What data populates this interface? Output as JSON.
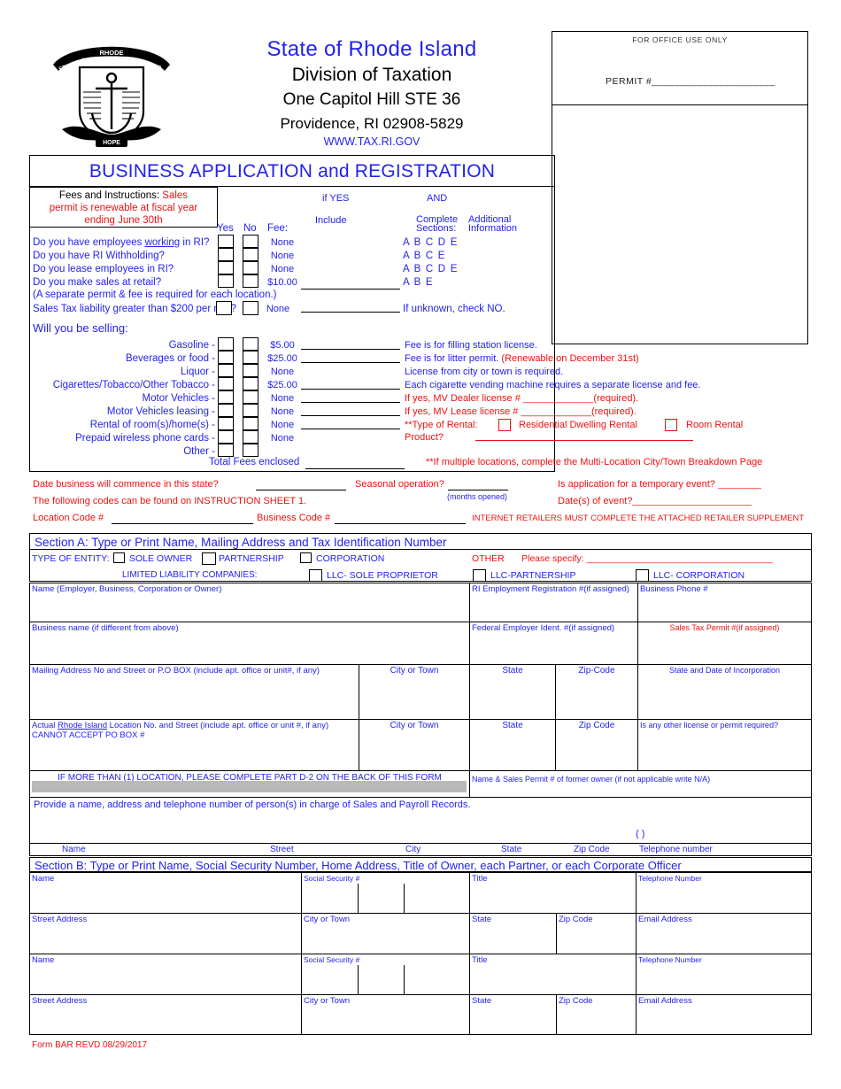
{
  "header": {
    "agency_line1": "State of Rhode Island",
    "agency_line2": "Division of Taxation",
    "agency_line3": "One Capitol Hill   STE 36",
    "agency_line4": "Providence, RI 02908-5829",
    "website": "WWW.TAX.RI.GOV",
    "seal_alt": "rhode-island-state-seal",
    "seal_top_text": "RHODE",
    "seal_left_text": "STATE OF",
    "seal_right_text": "ISLAND",
    "seal_bottom_text": "HOPE"
  },
  "office_use": {
    "title": "FOR OFFICE USE ONLY",
    "permit_label": "PERMIT #______________________"
  },
  "form_title": "BUSINESS APPLICATION and REGISTRATION",
  "fees_box": {
    "line1_black": "Fees and Instructions:",
    "line1_red": "Sales",
    "line2": "permit is renewable at fiscal year",
    "line3": "ending June 30th"
  },
  "column_headers": {
    "yes": "Yes",
    "no": "No",
    "fee": "Fee:",
    "if_yes": "if YES",
    "and": "AND",
    "include": "Include",
    "complete_sections_l1": "Complete",
    "complete_sections_l2": "Sections:",
    "additional_info_l1": "Additional",
    "additional_info_l2": "Information"
  },
  "questions": [
    {
      "label_pre": "Do you have employees ",
      "label_u": "working",
      "label_post": " in RI?",
      "fee": "None",
      "sections": "A B C D E"
    },
    {
      "label_pre": "Do you have RI Withholding?",
      "label_u": "",
      "label_post": "",
      "fee": "None",
      "sections": "A B C E"
    },
    {
      "label_pre": "Do you lease employees in RI?",
      "label_u": "",
      "label_post": "",
      "fee": "None",
      "sections": "A B C D E"
    },
    {
      "label_pre": "Do you make sales at retail?",
      "label_u": "",
      "label_post": "",
      "fee": "$10.00",
      "sections": "A B E"
    }
  ],
  "separate_permit_note": "(A separate permit & fee is required for each location.)",
  "sales_tax_liability": {
    "label": "Sales Tax liability greater than $200 per mo.?",
    "fee": "None",
    "note": "If unknown, check NO."
  },
  "selling": {
    "heading": "Will you be selling:",
    "rows": [
      {
        "label": "Gasoline -",
        "fee": "$5.00",
        "desc_blue": "Fee is for filling station license.",
        "desc_red": ""
      },
      {
        "label": "Beverages or food -",
        "fee": "$25.00",
        "desc_blue": "Fee is for litter permit.",
        "desc_red": " (Renewable on December 31st)"
      },
      {
        "label": "Liquor -",
        "fee": "None",
        "desc_blue": "License from city or town is required.",
        "desc_red": ""
      },
      {
        "label": "Cigarettes/Tobacco/Other Tobacco -",
        "fee": "$25.00",
        "desc_blue": "Each cigarette vending machine requires a separate license and fee.",
        "desc_red": ""
      },
      {
        "label": "Motor Vehicles -",
        "fee": "None",
        "desc_blue": "",
        "desc_red": "If yes, MV Dealer license # _____________(required)."
      },
      {
        "label": "Motor Vehicles leasing -",
        "fee": "None",
        "desc_blue": "",
        "desc_red": "If yes, MV Lease license # _____________(required)."
      },
      {
        "label": "Rental of room(s)/home(s) -",
        "fee": "None",
        "desc_blue": "",
        "desc_red": "**Type of Rental:"
      },
      {
        "label": "Prepaid wireless phone cards -",
        "fee": "None",
        "desc_blue": "",
        "desc_red": "Product?"
      },
      {
        "label": "Other -",
        "fee": "",
        "desc_blue": "",
        "desc_red": ""
      }
    ],
    "rental_option_1": "Residential Dwelling Rental",
    "rental_option_2": "Room Rental",
    "total_fees_label": "Total Fees enclosed",
    "multi_location_note": "**If multiple locations, complete the Multi-Location City/Town Breakdown Page"
  },
  "commence": {
    "date_label": "Date business will commence in this state?",
    "seasonal_label": "Seasonal operation?",
    "months_opened": "(months opened)",
    "temporary_event": "Is application for a temporary event? ________",
    "event_dates": "Date(s) of event?______________________",
    "instruction_sheet": "The following codes can be found on INSTRUCTION SHEET 1.",
    "location_code": "Location Code #",
    "business_code": "Business Code #",
    "internet_note": "INTERNET RETAILERS MUST COMPLETE THE ATTACHED RETAILER SUPPLEMENT"
  },
  "section_a": {
    "bar": "Section A:  Type or Print Name, Mailing Address and Tax Identification Number",
    "type_of_entity": "TYPE OF ENTITY:",
    "entity_options": [
      "SOLE OWNER",
      "PARTNERSHIP",
      "CORPORATION"
    ],
    "other": "OTHER",
    "please_specify": "Please specify:  ____________________________________",
    "llc_label": "LIMITED LIABILITY COMPANIES:",
    "llc_options": [
      "LLC- SOLE PROPRIETOR",
      "LLC-PARTNERSHIP",
      "LLC- CORPORATION"
    ],
    "row1": {
      "name": "Name (Employer, Business, Corporation or Owner)",
      "ri_employment": "RI Employment Registration #(if assigned)",
      "business_phone": "Business Phone #"
    },
    "row2": {
      "business_name": "Business name (if different from above)",
      "fein": "Federal Employer Ident. #(if assigned)",
      "sales_tax_permit": "Sales Tax Permit #(if assigned)"
    },
    "row3": {
      "mailing": "Mailing Address No and Street or P.O BOX (include apt. office or unit#, if any)",
      "city": "City or Town",
      "state": "State",
      "zip": "Zip-Code",
      "incorporation": "State and Date of Incorporation"
    },
    "row4": {
      "actual_pre": "Actual ",
      "actual_u": "Rhode Island",
      "actual_post": " Location No. and Street (include apt. office or unit #, if any)  CANNOT ACCEPT PO BOX #",
      "city": "City or Town",
      "state": "State",
      "zip": "Zip Code",
      "other_license": "Is any other license or permit required?"
    },
    "more_locations": "IF MORE THAN (1) LOCATION, PLEASE COMPLETE PART D-2 ON THE BACK OF THIS FORM",
    "former_owner": "Name & Sales Permit # of former owner (if not applicable write N/A)",
    "records_note": "Provide a name, address and telephone number of person(s) in charge of Sales and Payroll Records.",
    "phone_paren": "(          )",
    "records_headers": [
      "Name",
      "Street",
      "City",
      "State",
      "Zip Code",
      "Telephone number"
    ]
  },
  "section_b": {
    "bar": "Section B: Type or Print Name, Social Security Number, Home Address, Title of Owner, each Partner, or each Corporate Officer",
    "labels": {
      "name": "Name",
      "ssn": "Social Security #",
      "title": "Title",
      "telephone": "Telephone Number",
      "street": "Street Address",
      "city": "City or Town",
      "state": "State",
      "zip": "Zip Code",
      "email": "Email Address"
    }
  },
  "footer": "Form BAR    REVD 08/29/2017"
}
